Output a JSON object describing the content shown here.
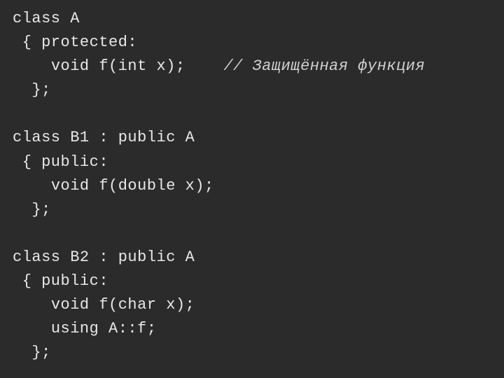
{
  "code": {
    "lines": [
      {
        "indent": "",
        "text": "class A"
      },
      {
        "indent": " ",
        "text": "{ protected:"
      },
      {
        "indent": "    ",
        "text": "void f(int x);    ",
        "comment": "// Защищённая функция"
      },
      {
        "indent": "  ",
        "text": "};"
      },
      {
        "indent": "",
        "text": ""
      },
      {
        "indent": "",
        "text": "class B1 : public A"
      },
      {
        "indent": " ",
        "text": "{ public:"
      },
      {
        "indent": "    ",
        "text": "void f(double x);"
      },
      {
        "indent": "  ",
        "text": "};"
      },
      {
        "indent": "",
        "text": ""
      },
      {
        "indent": "",
        "text": "class B2 : public A"
      },
      {
        "indent": " ",
        "text": "{ public:"
      },
      {
        "indent": "    ",
        "text": "void f(char x);"
      },
      {
        "indent": "    ",
        "text": "using A::f;"
      },
      {
        "indent": "  ",
        "text": "};"
      }
    ]
  }
}
